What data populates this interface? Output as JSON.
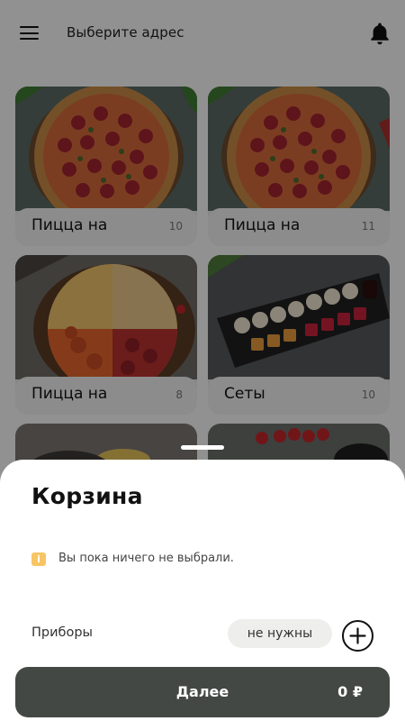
{
  "header": {
    "address_placeholder": "Выберите адрес",
    "menu_icon": "menu-icon",
    "notifications_icon": "bell-icon"
  },
  "categories": [
    {
      "title": "Пицца на",
      "count": "10",
      "image": "pizza-pepperoni"
    },
    {
      "title": "Пицца на",
      "count": "11",
      "image": "pizza-pepperoni"
    },
    {
      "title": "Пицца на",
      "count": "8",
      "image": "pizza-mixed"
    },
    {
      "title": "Сеты",
      "count": "10",
      "image": "sushi-set"
    },
    {
      "title": "",
      "count": "",
      "image": "food"
    },
    {
      "title": "",
      "count": "",
      "image": "food"
    }
  ],
  "cart": {
    "title": "Корзина",
    "empty_message": "Вы пока ничего не выбрали.",
    "info_icon": "info-icon",
    "cutlery_label": "Приборы",
    "cutlery_value": "не нужны",
    "add_icon": "plus-icon",
    "next_label": "Далее",
    "total": "0 ₽"
  },
  "colors": {
    "button_dark": "#444845",
    "info_accent": "#f7c564",
    "chip_background": "#eeeeec"
  }
}
